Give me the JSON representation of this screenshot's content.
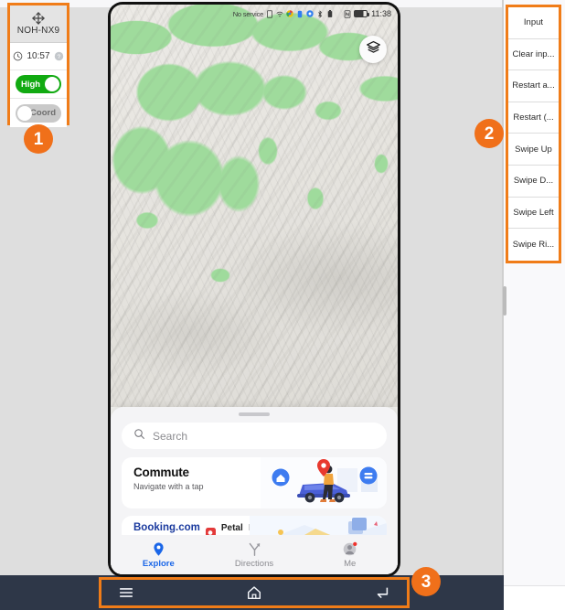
{
  "device_panel": {
    "move_handle_icon": "move-crosshair-icon",
    "device_name": "NOH-NX9",
    "clock_icon": "clock-icon",
    "time": "10:57",
    "help_icon": "help-circle-icon",
    "quality_toggle": {
      "label": "High",
      "state": "on"
    },
    "coord_toggle": {
      "label": "Coord",
      "state": "off"
    }
  },
  "markers": {
    "one": "1",
    "two": "2",
    "three": "3"
  },
  "actions": {
    "buttons": [
      {
        "label": "Input",
        "name": "input"
      },
      {
        "label": "Clear inp...",
        "name": "clear-input"
      },
      {
        "label": "Restart a...",
        "name": "restart-app"
      },
      {
        "label": "Restart (...",
        "name": "restart-other"
      },
      {
        "label": "Swipe Up",
        "name": "swipe-up"
      },
      {
        "label": "Swipe D...",
        "name": "swipe-down"
      },
      {
        "label": "Swipe Left",
        "name": "swipe-left"
      },
      {
        "label": "Swipe Ri...",
        "name": "swipe-right"
      }
    ]
  },
  "phone": {
    "statusbar": {
      "carrier": "No service",
      "icons": [
        "sim-icon",
        "wifi-icon",
        "chrome-icon",
        "app-blue-icon",
        "app-circle-icon",
        "bluetooth-icon",
        "battery-saver-icon"
      ],
      "nfc_icon": "nfc-icon",
      "battery_icon": "battery-icon",
      "time": "11:38"
    },
    "map": {
      "layers_button_icon": "layers-icon",
      "info_button_icon": "exclamation-circle-icon"
    },
    "sheet": {
      "grabber": "sheet-grabber",
      "search": {
        "icon": "search-icon",
        "placeholder": "Search"
      },
      "commute_card": {
        "title": "Commute",
        "subtitle": "Navigate with a tap",
        "art": "commute-illustration"
      },
      "partner_card": {
        "brand": "Booking.com",
        "badge_icon": "petal-maps-icon",
        "app_name": "Petal",
        "app_name_suffix": "Maps"
      }
    },
    "tabs": [
      {
        "label": "Explore",
        "icon": "map-pin-icon",
        "active": true
      },
      {
        "label": "Directions",
        "icon": "directions-arrow-icon",
        "active": false
      },
      {
        "label": "Me",
        "icon": "avatar-icon",
        "active": false
      }
    ]
  },
  "navbar": {
    "recents_icon": "hamburger-recents-icon",
    "home_icon": "home-icon",
    "back_icon": "back-icon"
  },
  "colors": {
    "accent_orange": "#F07C18",
    "toggle_on_green": "#11AA11",
    "toggle_off_gray": "#c9c9c9",
    "navbar_navy": "#2e3748",
    "tab_active_blue": "#1a66e8",
    "map_green": "#9fdb9c",
    "booking_blue": "#1a3a9e",
    "petal_red": "#e33a3a"
  }
}
